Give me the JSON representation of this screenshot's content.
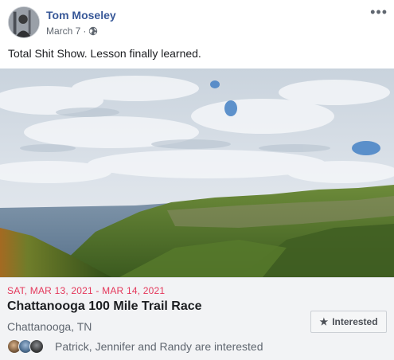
{
  "post": {
    "author": "Tom Moseley",
    "timestamp": "March 7",
    "separator": "·",
    "privacy_icon": "globe-icon",
    "more_icon": "more-options-icon",
    "more_glyph": "•••",
    "text": "Total Shit Show. Lesson finally learned."
  },
  "event": {
    "date": "SAT, MAR 13, 2021 - MAR 14, 2021",
    "title": "Chattanooga 100 Mile Trail Race",
    "location": "Chattanooga, TN",
    "interested_button": "Interested",
    "interested_icon": "star-icon",
    "friends_text": "Patrick, Jennifer and Randy are interested"
  },
  "colors": {
    "author_link": "#385898",
    "date_red": "#e4385b",
    "event_bg": "#f2f3f5",
    "secondary_text": "#606770"
  }
}
